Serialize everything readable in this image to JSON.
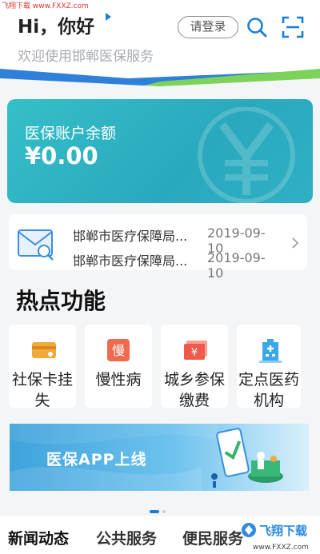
{
  "watermark": {
    "top_text": "飞翔下载 www.FXXZ.com",
    "logo_text": "飞翔下载",
    "url_text": "www.FXXZ.com"
  },
  "header": {
    "greeting": "Hi，你好",
    "subtitle": "欢迎使用邯郸医保服务",
    "login_label": "请登录"
  },
  "balance": {
    "title": "医保账户余额",
    "amount": "¥0.00"
  },
  "notices": [
    {
      "title": "邯郸市医疗保障局...",
      "date": "2019-09-10"
    },
    {
      "title": "邯郸市医疗保障局...",
      "date": "2019-09-10"
    }
  ],
  "hot": {
    "title": "热点功能",
    "items": [
      {
        "label": "社保卡挂失",
        "icon": "card-icon",
        "color": "#f2a93b"
      },
      {
        "label": "慢性病",
        "icon": "chronic-icon",
        "color": "#f06a4f"
      },
      {
        "label": "城乡参保缴费",
        "icon": "yen-bill-icon",
        "color": "#f05a4a"
      },
      {
        "label": "定点医药机构",
        "icon": "hospital-icon",
        "color": "#3aa7e8"
      }
    ]
  },
  "promo": {
    "text": "医保APP上线"
  },
  "tabs": [
    {
      "label": "新闻动态"
    },
    {
      "label": "公共服务"
    },
    {
      "label": "便民服务"
    }
  ],
  "colors": {
    "accent": "#1a7fd6",
    "card_teal": "#2aa9be",
    "green_stripe": "#7dd35a"
  }
}
